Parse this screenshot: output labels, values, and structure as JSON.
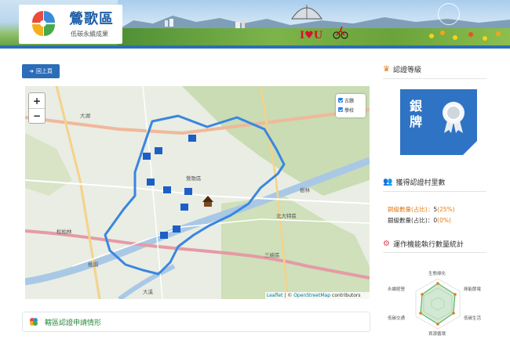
{
  "header": {
    "title": "鶯歌區",
    "subtitle": "低碳永續成果",
    "banner_slogan": "I♥U"
  },
  "toolbar": {
    "back_label": "回上頁"
  },
  "map": {
    "zoom_in": "+",
    "zoom_out": "−",
    "layers": [
      {
        "label": "古蹟",
        "checked": true
      },
      {
        "label": "學校",
        "checked": true
      }
    ],
    "attribution": {
      "leaflet": "Leaflet",
      "sep": " | © ",
      "osm": "OpenStreetMap",
      "tail": " contributors"
    },
    "labels": [
      "樹林",
      "北大特區",
      "三峽區",
      "鶯歌區",
      "大湖",
      "松柏林",
      "桃園",
      "大溪"
    ]
  },
  "section": {
    "title": "轄區認證申請情形"
  },
  "sidebar": {
    "cert_level": {
      "heading": "認證等級",
      "badge_text": "銀牌"
    },
    "villages": {
      "heading": "獲得認證村里數",
      "bronze_label": "銅級數量(占比)：",
      "bronze_value": "5",
      "bronze_pct": "(25%)",
      "silver_label": "銀級數量(占比)：",
      "silver_value": "0",
      "silver_pct": "(0%)"
    },
    "functions": {
      "heading": "運作機能執行數量統計",
      "axes": [
        "生態綠化",
        "綠能節電",
        "低碳生活",
        "資源循環",
        "低碳交通",
        "永續經營"
      ]
    }
  },
  "colors": {
    "brand_blue": "#2c6db8",
    "route_blue": "#3a86e0",
    "heading_green": "#2b8a3e",
    "accent_orange": "#e07b1a"
  }
}
